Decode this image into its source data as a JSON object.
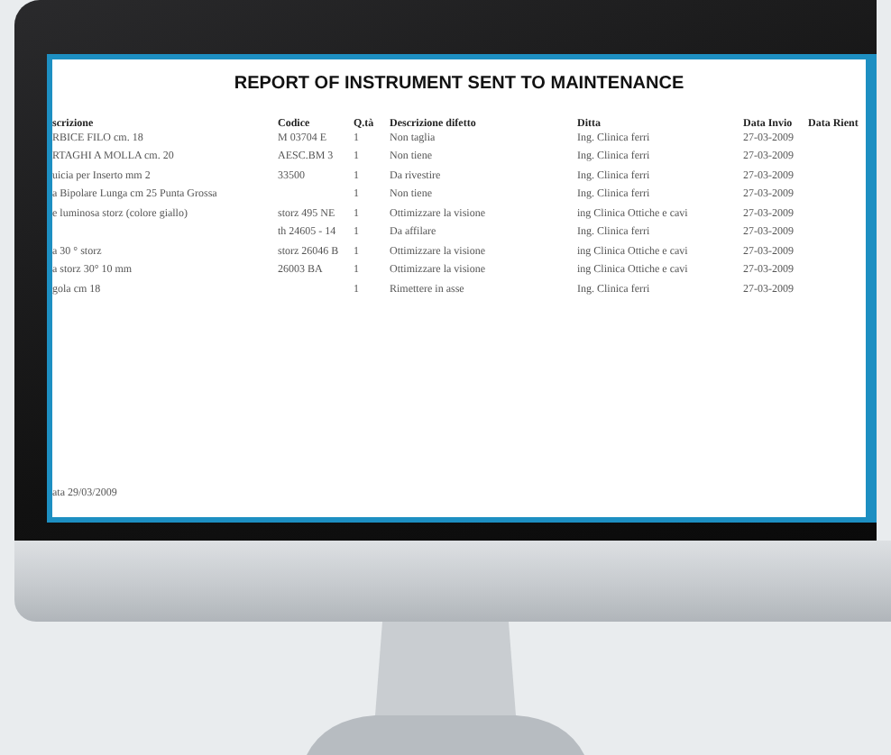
{
  "report": {
    "title": "REPORT OF INSTRUMENT SENT TO MAINTENANCE",
    "columns": [
      "scrizione",
      "Codice",
      "Q.tà",
      "Descrizione difetto",
      "Ditta",
      "Data Invio",
      "Data Rient"
    ],
    "rows": [
      [
        "RBICE FILO cm. 18",
        "M 03704 E",
        "1",
        "Non taglia",
        "Ing. Clinica ferri",
        "27-03-2009"
      ],
      [
        "RTAGHI A MOLLA cm. 20",
        "AESC.BM 3",
        "1",
        "Non tiene",
        "Ing. Clinica ferri",
        "27-03-2009"
      ],
      [
        "uicia per Inserto mm 2",
        "33500",
        "1",
        "Da rivestire",
        "Ing. Clinica ferri",
        "27-03-2009"
      ],
      [
        "a Bipolare Lunga cm 25 Punta Grossa",
        "",
        "1",
        "Non tiene",
        "Ing. Clinica ferri",
        "27-03-2009"
      ],
      [
        "e luminosa storz (colore giallo)",
        "storz 495 NE",
        "1",
        "Ottimizzare la visione",
        "ing Clinica Ottiche e cavi",
        "27-03-2009"
      ],
      [
        "",
        "th 24605 - 14",
        "1",
        "Da affilare",
        "Ing. Clinica ferri",
        "27-03-2009"
      ],
      [
        "a 30 ° storz",
        "storz 26046 B",
        "1",
        "Ottimizzare la visione",
        "ing Clinica Ottiche e cavi",
        "27-03-2009"
      ],
      [
        "a  storz 30° 10 mm",
        "26003 BA",
        "1",
        "Ottimizzare la visione",
        "ing Clinica Ottiche e cavi",
        "27-03-2009"
      ],
      [
        "gola cm 18",
        "",
        "1",
        "Rimettere in asse",
        "Ing. Clinica ferri",
        "27-03-2009"
      ]
    ],
    "footer": "ata 29/03/2009"
  }
}
